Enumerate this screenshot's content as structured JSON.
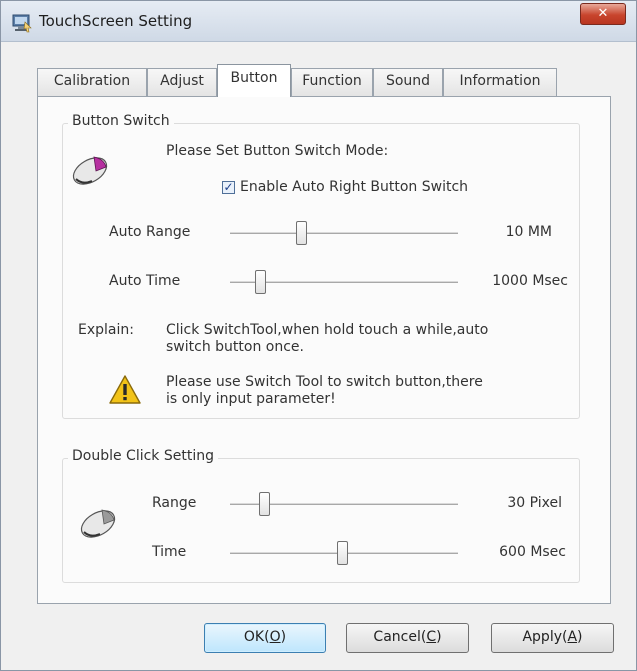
{
  "window": {
    "title": "TouchScreen Setting",
    "close_label": "✕"
  },
  "tabs": [
    {
      "label": "Calibration",
      "active": false
    },
    {
      "label": "Adjust",
      "active": false
    },
    {
      "label": "Button",
      "active": true
    },
    {
      "label": "Function",
      "active": false
    },
    {
      "label": "Sound",
      "active": false
    },
    {
      "label": "Information",
      "active": false
    }
  ],
  "button_switch": {
    "group_title": "Button Switch",
    "prompt": "Please Set Button Switch Mode:",
    "checkbox_label": "Enable Auto Right Button Switch",
    "checkbox_checked": true,
    "auto_range": {
      "label": "Auto Range",
      "value_text": "10  MM",
      "level": 0.31
    },
    "auto_time": {
      "label": "Auto Time",
      "value_text": "1000  Msec",
      "level": 0.13
    },
    "explain_label": "Explain:",
    "explain_line1": "Click SwitchTool,when hold touch a while,auto",
    "explain_line2": "switch button once.",
    "warning_line1": "Please use Switch Tool to switch button,there",
    "warning_line2": "is only input parameter!"
  },
  "double_click": {
    "group_title": "Double Click Setting",
    "range": {
      "label": "Range",
      "value_text": "30  Pixel",
      "level": 0.15
    },
    "time": {
      "label": "Time",
      "value_text": "600  Msec",
      "level": 0.49
    }
  },
  "buttons": {
    "ok_text": "OK(",
    "ok_key": "O",
    "ok_end": ")",
    "cancel_text": "Cancel(",
    "cancel_key": "C",
    "cancel_end": ")",
    "apply_text": "Apply(",
    "apply_key": "A",
    "apply_end": ")"
  }
}
